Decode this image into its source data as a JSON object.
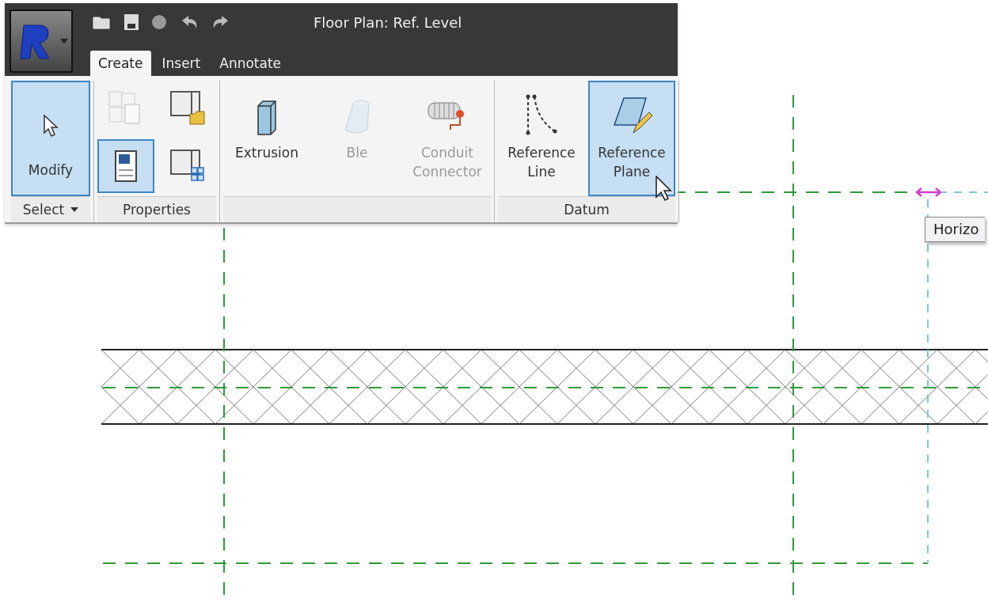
{
  "title": "Floor Plan: Ref. Level",
  "tabs": [
    {
      "label": "Create",
      "selected": true
    },
    {
      "label": "Insert",
      "selected": false
    },
    {
      "label": "Annotate",
      "selected": false
    }
  ],
  "panels": [
    {
      "label": "Select",
      "dropdown": true,
      "tools": [
        {
          "kind": "large",
          "label": "Modify",
          "selected": true
        }
      ]
    },
    {
      "label": "Properties",
      "tools": [
        {
          "kind": "small",
          "selected": false
        },
        {
          "kind": "small",
          "selected": false
        },
        {
          "kind": "small",
          "selected": true
        },
        {
          "kind": "small",
          "selected": false
        }
      ]
    },
    {
      "tools": [
        {
          "kind": "large",
          "label": "Extrusion",
          "selected": false
        },
        {
          "kind": "large",
          "label": "Ble",
          "selected": false
        },
        {
          "kind": "large",
          "label": "Conduit Connector",
          "selected": false
        }
      ]
    },
    {
      "label": "Datum",
      "tools": [
        {
          "kind": "large",
          "label": "Reference Line",
          "selected": false
        },
        {
          "kind": "large",
          "label": "Reference Plane",
          "selected": true
        }
      ]
    }
  ],
  "tooltip": {
    "text": "Horizo"
  }
}
